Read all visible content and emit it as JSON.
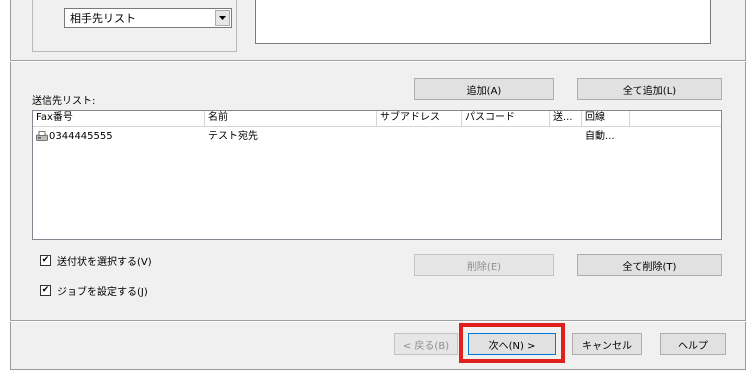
{
  "header": {
    "combo_value": "相手先リスト"
  },
  "dest_list": {
    "label": "送信先リスト:",
    "add_button": "追加(A)",
    "add_all_button": "全て追加(L)",
    "columns": [
      "Fax番号",
      "名前",
      "サブアドレス",
      "パスコード",
      "送...",
      "回線"
    ],
    "rows": [
      {
        "fax": "0344445555",
        "name": "テスト宛先",
        "subaddress": "",
        "passcode": "",
        "send": "",
        "line": "自動..."
      }
    ],
    "delete_button": "削除(E)",
    "delete_all_button": "全て削除(T)"
  },
  "options": {
    "select_cover_label": "送付状を選択する(V)",
    "select_cover_checked": true,
    "set_job_label": "ジョブを設定する(J)",
    "set_job_checked": true
  },
  "footer": {
    "back_button": "< 戻る(B)",
    "next_button": "次へ(N) >",
    "cancel_button": "キャンセル",
    "help_button": "ヘルプ"
  },
  "colors": {
    "highlight": "#e0201c",
    "dialog_bg": "#f0f0f0",
    "focus_border": "#0078d7"
  },
  "icons": {
    "fax_row_icon": "fax-machine-icon",
    "combo_arrow": "chevron-down-icon",
    "check_mark": "checkmark-icon"
  }
}
